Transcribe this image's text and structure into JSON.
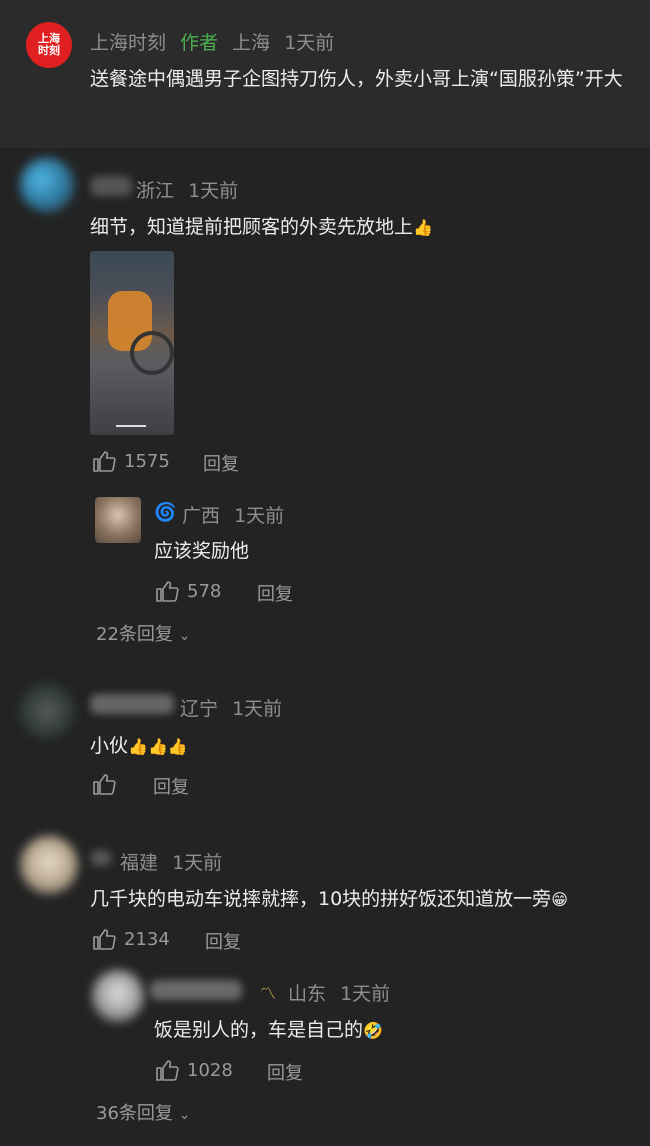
{
  "post": {
    "logo_text": "上海时刻",
    "author": "上海时刻",
    "author_badge": "作者",
    "location": "上海",
    "time": "1天前",
    "text": "送餐途中偶遇男子企图持刀伤人，外卖小哥上演“国服孙策”开大"
  },
  "comments": [
    {
      "location": "浙江",
      "time": "1天前",
      "text": "细节，知道提前把顾客的外卖先放地上",
      "emoji": "thumbs-up-emoji",
      "likes": "1575",
      "reply_label": "回复",
      "replies": [
        {
          "location": "广西",
          "time": "1天前",
          "text": "应该奖励他",
          "likes": "578",
          "reply_label": "回复"
        }
      ],
      "more_replies": "22条回复"
    },
    {
      "location": "辽宁",
      "time": "1天前",
      "text": "小伙",
      "emoji_count": 3,
      "likes": "",
      "reply_label": "回复"
    },
    {
      "location": "福建",
      "time": "1天前",
      "text": "几千块的电动车说摔就摔，10块的拼好饭还知道放一旁",
      "emoji": "grin-emoji",
      "likes": "2134",
      "reply_label": "回复",
      "replies": [
        {
          "location": "山东",
          "time": "1天前",
          "text": "饭是别人的，车是自己的",
          "emoji": "laugh-cry-emoji",
          "likes": "1028",
          "reply_label": "回复"
        }
      ],
      "more_replies": "36条回复"
    }
  ],
  "colors": {
    "background": "#232323",
    "top_card": "#2b2b2b",
    "author_badge": "#4caf50",
    "logo_red": "#e02020"
  }
}
